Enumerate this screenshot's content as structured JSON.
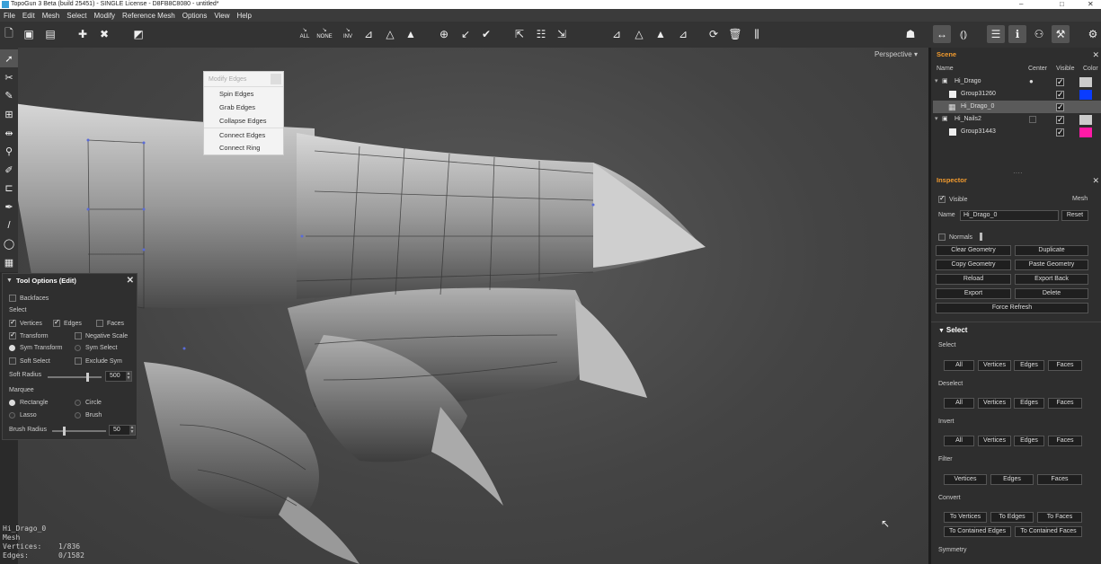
{
  "window": {
    "title": "TopoGun 3 Beta (build 25451) - SINGLE License - D8FB8C8080 - untitled*"
  },
  "menu": [
    "File",
    "Edit",
    "Mesh",
    "Select",
    "Modify",
    "Reference Mesh",
    "Options",
    "View",
    "Help"
  ],
  "toolbar": {
    "select_all": "ALL",
    "select_none": "NONE",
    "select_invert": "INV"
  },
  "viewport": {
    "camera_mode": "Perspective"
  },
  "modify_popup": {
    "title": "Modify Edges",
    "items": [
      "Spin Edges",
      "Grab Edges",
      "Collapse Edges",
      "Connect Edges",
      "Connect Ring"
    ]
  },
  "tool_options": {
    "title": "Tool Options (Edit)",
    "backfaces": "Backfaces",
    "select_label": "Select",
    "vertices": "Vertices",
    "edges": "Edges",
    "faces": "Faces",
    "transform": "Transform",
    "negative_scale": "Negative Scale",
    "sym_transform": "Sym Transform",
    "sym_select": "Sym Select",
    "soft_select": "Soft Select",
    "exclude_sym": "Exclude Sym",
    "soft_radius_label": "Soft Radius",
    "soft_radius": "500",
    "soft_radius_level": 0.72,
    "marquee_label": "Marquee",
    "rectangle": "Rectangle",
    "circle": "Circle",
    "lasso": "Lasso",
    "brush": "Brush",
    "brush_radius_label": "Brush Radius",
    "brush_radius": "50",
    "brush_radius_level": 0.2
  },
  "mesh_info": {
    "name": "Hi_Drago_0",
    "type": "Mesh",
    "vertices_label": "Vertices:",
    "vertices": "1/836",
    "edges_label": "Edges:",
    "edges": "0/1582"
  },
  "scene": {
    "title": "Scene",
    "columns": {
      "name": "Name",
      "center": "Center",
      "visible": "Visible",
      "color": "Color"
    },
    "rows": [
      {
        "name": "Hi_Drago",
        "color": "#cccccc"
      },
      {
        "name": "Group31260",
        "color": "#0a3cff"
      },
      {
        "name": "Hi_Drago_0",
        "color": ""
      },
      {
        "name": "Hi_Nails2",
        "color": "#cccccc"
      },
      {
        "name": "Group31443",
        "color": "#ff1aa6"
      }
    ]
  },
  "inspector": {
    "title": "Inspector",
    "visible": "Visible",
    "kind": "Mesh",
    "name_label": "Name",
    "name_value": "Hi_Drago_0",
    "reset": "Reset",
    "normals": "Normals",
    "buttons": [
      "Clear Geometry",
      "Duplicate",
      "Copy Geometry",
      "Paste Geometry",
      "Reload",
      "Export Back",
      "Export",
      "Delete"
    ],
    "force_refresh": "Force Refresh"
  },
  "select_panel": {
    "title": "Select",
    "select": "Select",
    "deselect": "Deselect",
    "invert": "Invert",
    "filter": "Filter",
    "convert": "Convert",
    "symmetry": "Symmetry",
    "all": "All",
    "vertices": "Vertices",
    "edges": "Edges",
    "faces": "Faces",
    "to_vertices": "To Vertices",
    "to_edges": "To Edges",
    "to_faces": "To Faces",
    "to_contained_edges": "To Contained Edges",
    "to_contained_faces": "To Contained Faces"
  }
}
